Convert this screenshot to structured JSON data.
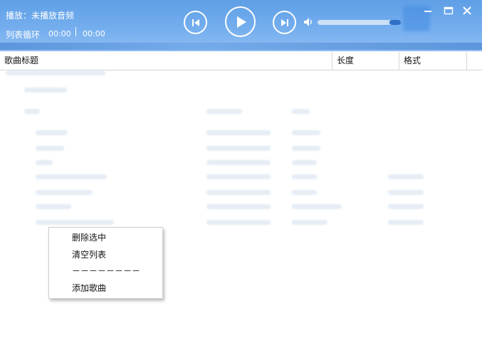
{
  "player": {
    "now_playing": "播放：未播放音频",
    "play_mode": "列表循环",
    "current_time": "00:00",
    "total_time": "00:00",
    "volume_level": 0.85,
    "accent_color": "#5f9fe6"
  },
  "controls": {
    "prev_icon": "skip-previous-icon",
    "play_icon": "play-icon",
    "next_icon": "skip-next-icon",
    "volume_icon": "speaker-icon"
  },
  "window": {
    "minimize_icon": "minimize-icon",
    "maximize_icon": "maximize-icon",
    "close_icon": "close-icon"
  },
  "list": {
    "columns": [
      "歌曲标题",
      "长度",
      "格式"
    ],
    "rows": []
  },
  "context_menu": {
    "items": [
      "删除选中",
      "清空列表",
      "－－－－－－－－",
      "添加歌曲"
    ]
  }
}
